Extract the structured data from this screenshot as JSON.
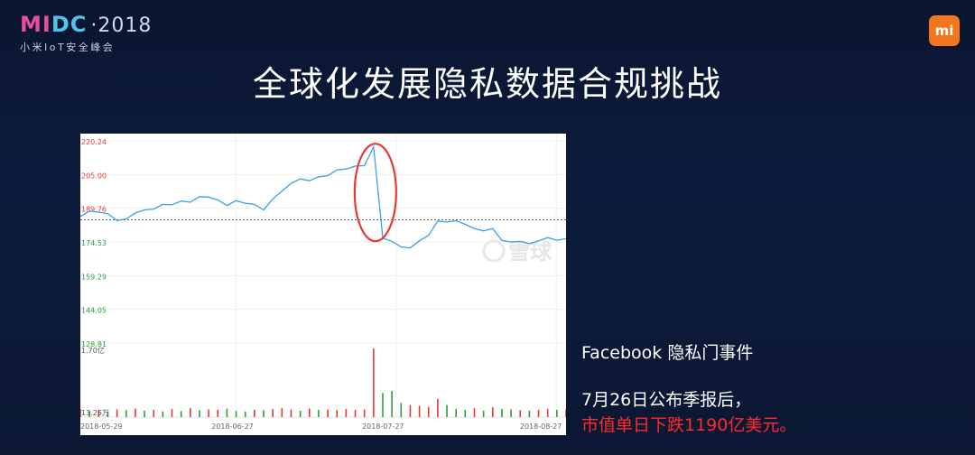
{
  "header": {
    "logo_m": "MI",
    "logo_d": "DC",
    "logo_year": "·2018",
    "logo_sub": "小米IoT安全峰会",
    "brand_badge": "mi"
  },
  "title": "全球化发展隐私数据合规挑战",
  "chart_data": {
    "type": "line",
    "price_axis_labels": [
      "220.24",
      "205.00",
      "189.76",
      "174.53",
      "159.29",
      "144.05",
      "128.81"
    ],
    "price_axis_colors": [
      "#e53935",
      "#e53935",
      "#e53935",
      "#2e9e3a",
      "#2e9e3a",
      "#2e9e3a",
      "#2e9e3a"
    ],
    "ylim": [
      128.81,
      220.24
    ],
    "reference_price": 184.5,
    "x_labels": [
      "2018-05-29",
      "2018-06-27",
      "2018-07-27",
      "2018-08-27"
    ],
    "price_series": [
      186.0,
      188.5,
      188.0,
      187.3,
      184.2,
      184.9,
      187.6,
      189.0,
      189.4,
      191.5,
      191.3,
      193.0,
      192.5,
      195.0,
      194.8,
      193.5,
      191.0,
      193.2,
      192.0,
      191.5,
      189.0,
      194.0,
      197.5,
      201.0,
      203.0,
      202.2,
      204.0,
      204.5,
      207.1,
      207.5,
      208.8,
      209.0,
      217.5,
      176.3,
      174.8,
      172.3,
      171.8,
      175.0,
      177.5,
      184.0,
      183.5,
      184.1,
      182.5,
      180.6,
      179.5,
      180.6,
      175.2,
      174.5,
      174.8,
      173.7,
      175.0,
      176.5,
      175.3,
      176.0
    ],
    "volume_axis_labels": [
      "1.70亿",
      "13.25万"
    ],
    "volume_series": [
      0.2,
      0.15,
      0.18,
      0.14,
      0.19,
      0.17,
      0.21,
      0.16,
      0.18,
      0.14,
      0.2,
      0.15,
      0.22,
      0.17,
      0.19,
      0.18,
      0.21,
      0.15,
      0.14,
      0.18,
      0.17,
      0.2,
      0.22,
      0.19,
      0.16,
      0.21,
      0.18,
      0.19,
      0.17,
      0.2,
      0.18,
      0.19,
      1.7,
      0.6,
      0.65,
      0.35,
      0.3,
      0.28,
      0.25,
      0.45,
      0.3,
      0.2,
      0.18,
      0.22,
      0.16,
      0.24,
      0.2,
      0.19,
      0.17,
      0.16,
      0.18,
      0.2,
      0.18,
      0.19
    ],
    "volume_colors": [
      "r",
      "g",
      "r",
      "g",
      "r",
      "g",
      "r",
      "g",
      "r",
      "g",
      "r",
      "g",
      "r",
      "g",
      "r",
      "r",
      "g",
      "g",
      "g",
      "r",
      "g",
      "r",
      "r",
      "r",
      "g",
      "r",
      "g",
      "r",
      "r",
      "r",
      "r",
      "r",
      "r",
      "g",
      "g",
      "g",
      "r",
      "r",
      "r",
      "r",
      "g",
      "g",
      "g",
      "r",
      "g",
      "r",
      "g",
      "g",
      "r",
      "g",
      "r",
      "r",
      "g",
      "r"
    ],
    "watermark": "雪球",
    "annotation": "ellipse-highlight-drop",
    "colors": {
      "line": "#3ba0e6",
      "up": "#e53935",
      "down": "#2e9e3a",
      "highlight": "#e53935"
    }
  },
  "notes": {
    "event": "Facebook 隐私门事件",
    "line1": "7月26日公布季报后，",
    "line2": "市值单日下跌1190亿美元。"
  }
}
